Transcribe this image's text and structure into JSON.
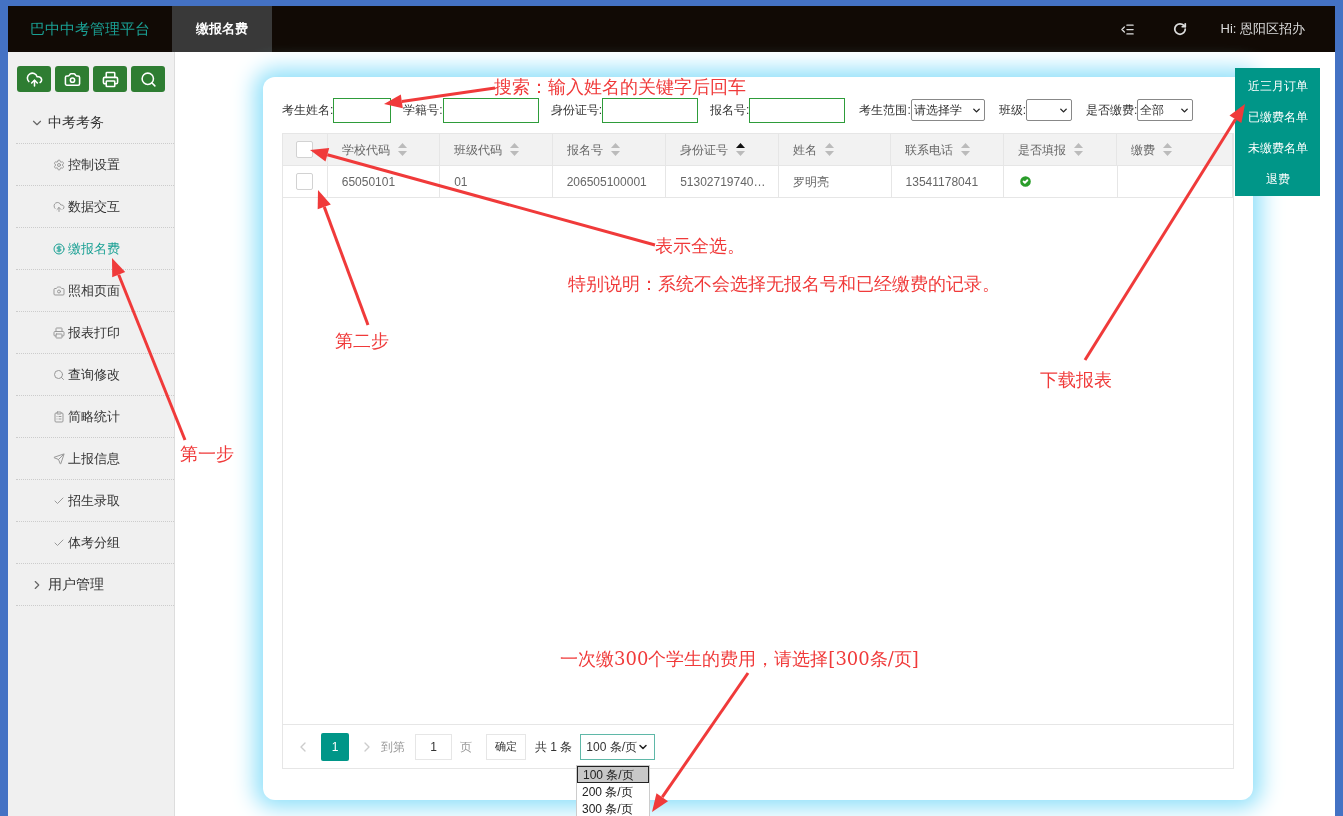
{
  "header": {
    "logo": "巴中中考管理平台",
    "tabs": [
      {
        "label": "缴报名费",
        "selected": true
      }
    ],
    "user": "Hi: 恩阳区招办"
  },
  "sidebar": {
    "nav": [
      {
        "label": "中考考务",
        "expanded": true,
        "children": [
          {
            "label": "控制设置",
            "selected": false
          },
          {
            "label": "数据交互",
            "selected": false
          },
          {
            "label": "缴报名费",
            "selected": true
          },
          {
            "label": "照相页面",
            "selected": false
          },
          {
            "label": "报表打印",
            "selected": false
          },
          {
            "label": "查询修改",
            "selected": false
          },
          {
            "label": "简略统计",
            "selected": false
          },
          {
            "label": "上报信息",
            "selected": false
          },
          {
            "label": "招生录取",
            "selected": false
          },
          {
            "label": "体考分组",
            "selected": false
          }
        ]
      },
      {
        "label": "用户管理",
        "expanded": false
      }
    ]
  },
  "filters": [
    {
      "label": "考生姓名:",
      "kind": "input"
    },
    {
      "label": "学籍号:",
      "kind": "input"
    },
    {
      "label": "身份证号:",
      "kind": "input"
    },
    {
      "label": "报名号:",
      "kind": "input"
    },
    {
      "label": "考生范围:",
      "kind": "select",
      "value": "请选择学"
    },
    {
      "label": "班级:",
      "kind": "select"
    },
    {
      "label": "是否缴费:",
      "kind": "select",
      "value": "全部"
    }
  ],
  "table": {
    "select_all": {
      "checked": false
    },
    "columns": [
      {
        "label": "学校代码",
        "sorted": false
      },
      {
        "label": "班级代码",
        "sorted": false
      },
      {
        "label": "报名号",
        "sorted": false
      },
      {
        "label": "身份证号",
        "sorted": true
      },
      {
        "label": "姓名",
        "sorted": false
      },
      {
        "label": "联系电话",
        "sorted": false
      },
      {
        "label": "是否填报",
        "sorted": false
      },
      {
        "label": "缴费",
        "sorted": false
      }
    ],
    "rows": [
      {
        "checked": false,
        "reported": true,
        "cells": [
          "65050101",
          "01",
          "206505100001",
          "51302719740…",
          "罗明亮",
          "13541178041"
        ]
      }
    ]
  },
  "pagination": {
    "pages": [
      {
        "label": "1",
        "selected": true
      }
    ],
    "goto_label": "到第",
    "goto_value": "1",
    "page_unit": "页",
    "confirm": "确定",
    "total": "共 1 条",
    "page_size": "100 条/页",
    "page_size_options": [
      {
        "label": "100 条/页",
        "selected": true
      },
      {
        "label": "200 条/页",
        "selected": false
      },
      {
        "label": "300 条/页",
        "selected": false
      }
    ]
  },
  "download_menu": [
    "近三月订单",
    "已缴费名单",
    "未缴费名单",
    "退费"
  ],
  "annotations": [
    "搜索：输入姓名的关键字后回车",
    "表示全选。",
    "特别说明：系统不会选择无报名号和已经缴费的记录。",
    "第二步",
    "第一步",
    "下载报表",
    "一次缴300个学生的费用，请选择[300条/页]"
  ]
}
